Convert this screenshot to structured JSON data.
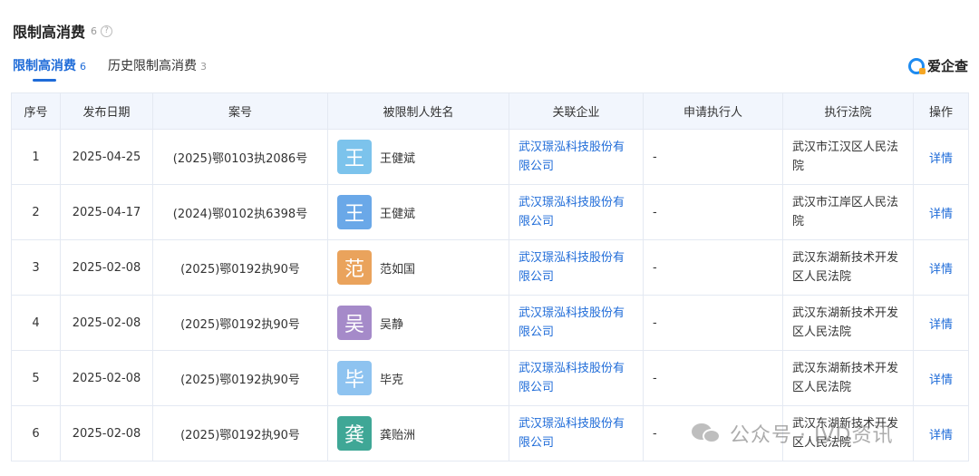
{
  "section": {
    "title": "限制高消费",
    "count": "6",
    "help_icon": "question-circle-icon"
  },
  "tabs": [
    {
      "label": "限制高消费",
      "count": "6",
      "active": true
    },
    {
      "label": "历史限制高消费",
      "count": "3",
      "active": false
    }
  ],
  "logo": {
    "text": "爱企查",
    "icon": "aiqicha-logo-icon"
  },
  "table": {
    "headers": [
      "序号",
      "发布日期",
      "案号",
      "被限制人姓名",
      "关联企业",
      "申请执行人",
      "执行法院",
      "操作"
    ],
    "rows": [
      {
        "index": "1",
        "date": "2025-04-25",
        "case_no": "(2025)鄂0103执2086号",
        "avatar_char": "王",
        "avatar_color": "#7cc3ec",
        "name": "王健斌",
        "company": "武汉璟泓科技股份有限公司",
        "applicant": "-",
        "court": "武汉市江汉区人民法院",
        "action": "详情"
      },
      {
        "index": "2",
        "date": "2025-04-17",
        "case_no": "(2024)鄂0102执6398号",
        "avatar_char": "王",
        "avatar_color": "#6aa8e8",
        "name": "王健斌",
        "company": "武汉璟泓科技股份有限公司",
        "applicant": "-",
        "court": "武汉市江岸区人民法院",
        "action": "详情"
      },
      {
        "index": "3",
        "date": "2025-02-08",
        "case_no": "(2025)鄂0192执90号",
        "avatar_char": "范",
        "avatar_color": "#eaa35c",
        "name": "范如国",
        "company": "武汉璟泓科技股份有限公司",
        "applicant": "-",
        "court": "武汉东湖新技术开发区人民法院",
        "action": "详情"
      },
      {
        "index": "4",
        "date": "2025-02-08",
        "case_no": "(2025)鄂0192执90号",
        "avatar_char": "吴",
        "avatar_color": "#a58ac9",
        "name": "吴静",
        "company": "武汉璟泓科技股份有限公司",
        "applicant": "-",
        "court": "武汉东湖新技术开发区人民法院",
        "action": "详情"
      },
      {
        "index": "5",
        "date": "2025-02-08",
        "case_no": "(2025)鄂0192执90号",
        "avatar_char": "毕",
        "avatar_color": "#8ec3f0",
        "name": "毕克",
        "company": "武汉璟泓科技股份有限公司",
        "applicant": "-",
        "court": "武汉东湖新技术开发区人民法院",
        "action": "详情"
      },
      {
        "index": "6",
        "date": "2025-02-08",
        "case_no": "(2025)鄂0192执90号",
        "avatar_char": "龚",
        "avatar_color": "#3fa796",
        "name": "龚贻洲",
        "company": "武汉璟泓科技股份有限公司",
        "applicant": "-",
        "court": "武汉东湖新技术开发区人民法院",
        "action": "详情"
      }
    ]
  },
  "watermark": {
    "text": "公众号 · IVD资讯",
    "icon": "wechat-icon"
  }
}
